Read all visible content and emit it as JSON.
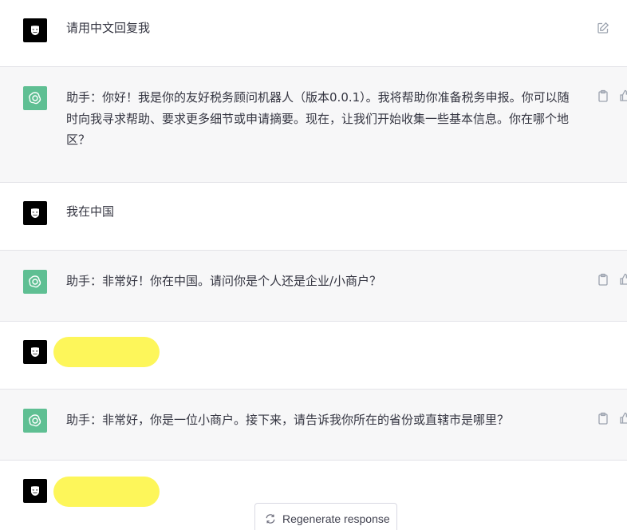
{
  "conversation": {
    "messages": [
      {
        "role": "user",
        "text": "请用中文回复我",
        "redacted": false
      },
      {
        "role": "assistant",
        "text": "助手：你好！我是你的友好税务顾问机器人（版本0.0.1）。我将帮助你准备税务申报。你可以随时向我寻求帮助、要求更多细节或申请摘要。现在，让我们开始收集一些基本信息。你在哪个地区？"
      },
      {
        "role": "user",
        "text": "我在中国",
        "redacted": false
      },
      {
        "role": "assistant",
        "text": "助手：非常好！你在中国。请问你是个人还是企业/小商户？"
      },
      {
        "role": "user",
        "text": "",
        "redacted": true
      },
      {
        "role": "assistant",
        "text": "助手：非常好，你是一位小商户。接下来，请告诉我你所在的省份或直辖市是哪里？"
      },
      {
        "role": "user",
        "text": "",
        "redacted": true
      }
    ]
  },
  "controls": {
    "regenerate_label": "Regenerate response"
  },
  "icons": {
    "user_avatar": "anonymous-mask-icon",
    "assistant_avatar": "openai-logo-icon",
    "edit": "edit-icon",
    "copy": "clipboard-icon",
    "like": "thumbs-up-icon",
    "regenerate": "refresh-icon"
  },
  "colors": {
    "assistant_bg": "#f7f7f8",
    "assistant_avatar": "#5fbf93",
    "highlight": "#fdf65a"
  }
}
